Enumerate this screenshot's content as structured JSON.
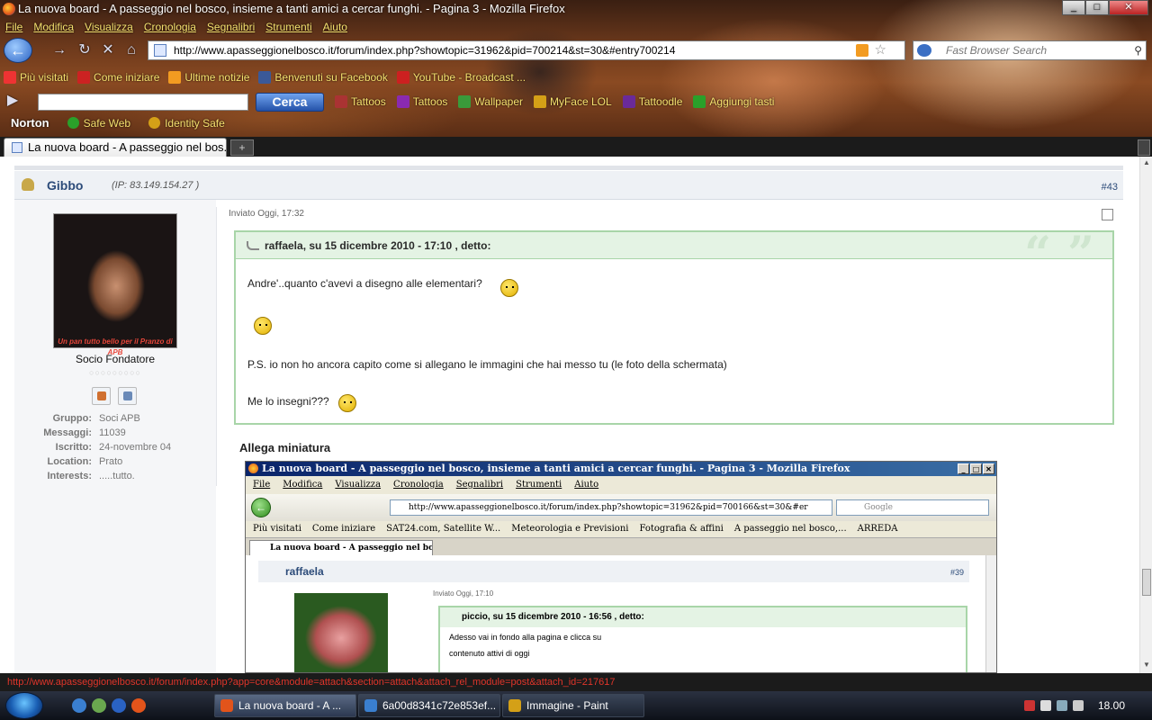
{
  "window": {
    "title": "La nuova board - A passeggio nel bosco, insieme a tanti amici a cercar funghi. - Pagina 3 - Mozilla Firefox",
    "controls": [
      "_",
      "□",
      "✕"
    ]
  },
  "menu": [
    "File",
    "Modifica",
    "Visualizza",
    "Cronologia",
    "Segnalibri",
    "Strumenti",
    "Aiuto"
  ],
  "nav": {
    "url": "http://www.apasseggionelbosco.it/forum/index.php?showtopic=31962&pid=700214&st=30&#entry700214",
    "search_placeholder": "Fast Browser Search"
  },
  "bookmarks": [
    {
      "label": "Più visitati",
      "color": "#e33"
    },
    {
      "label": "Come iniziare",
      "color": "#c22"
    },
    {
      "label": "Ultime notizie",
      "color": "#f29b21"
    },
    {
      "label": "Benvenuti su Facebook",
      "color": "#3b5998"
    },
    {
      "label": "YouTube - Broadcast ...",
      "color": "#cc2020"
    }
  ],
  "toolbar2": {
    "search_button": "Cerca",
    "links": [
      {
        "label": "Tattoos",
        "color": "#a33"
      },
      {
        "label": "Tattoos",
        "color": "#8a2ab0"
      },
      {
        "label": "Wallpaper",
        "color": "#3a9a3a"
      },
      {
        "label": "MyFace LOL",
        "color": "#d4a017"
      },
      {
        "label": "Tattoodle",
        "color": "#6a2a9a"
      },
      {
        "label": "Aggiungi tasti",
        "color": "#2aa02a"
      }
    ]
  },
  "norton": {
    "brand": "Norton",
    "items": [
      {
        "label": "Safe Web",
        "color": "#2aa02a"
      },
      {
        "label": "Identity Safe",
        "color": "#d4a017"
      }
    ]
  },
  "tab": {
    "label": "La nuova board - A passeggio nel bos...",
    "new_tab": "+"
  },
  "post": {
    "author": "Gibbo",
    "ip": "(IP: 83.149.154.27 )",
    "number": "#43",
    "date": "Inviato Oggi, 17:32",
    "avatar_caption": "Un pan tutto bello per il Pranzo di APB",
    "rank": "Socio Fondatore",
    "pips": "○○○○○○○○○",
    "meta": [
      {
        "k": "Gruppo:",
        "v": "Soci APB"
      },
      {
        "k": "Messaggi:",
        "v": "11039"
      },
      {
        "k": "Iscritto:",
        "v": "24-novembre 04"
      },
      {
        "k": "Location:",
        "v": "Prato"
      },
      {
        "k": "Interests:",
        "v": ".....tutto."
      }
    ],
    "quote": {
      "header": "raffaela, su 15 dicembre 2010 - 17:10 , detto:",
      "mark": "“ ”",
      "lines": [
        "Andre'..quanto c'avevi a disegno alle elementari?",
        "P.S. io non ho ancora capito come si allegano le immagini che hai messo tu (le foto della schermata)",
        "Me lo insegni???"
      ]
    },
    "attach_title": "Allega miniatura"
  },
  "shot": {
    "title": "La nuova board - A passeggio nel bosco, insieme a tanti amici a cercar funghi. - Pagina 3 - Mozilla Firefox",
    "menu": [
      "File",
      "Modifica",
      "Visualizza",
      "Cronologia",
      "Segnalibri",
      "Strumenti",
      "Aiuto"
    ],
    "url": "http://www.apasseggionelbosco.it/forum/index.php?showtopic=31962&pid=700166&st=30&#er",
    "search": "Google",
    "bookmarks": [
      "Più visitati",
      "Come iniziare",
      "SAT24.com, Satellite W...",
      "Meteorologia e Previsioni",
      "Fotografia & affini",
      "A passeggio nel bosco,...",
      "ARREDA"
    ],
    "tab": "La nuova board - A passeggio nel bosc...",
    "author": "raffaela",
    "number": "#39",
    "date": "Inviato Oggi, 17:10",
    "quote_header": "piccio, su 15 dicembre 2010 - 16:56 , detto:",
    "quote_lines": [
      "Adesso vai in fondo alla pagina e clicca su",
      "contenuto attivi di oggi"
    ]
  },
  "status": "http://www.apasseggionelbosco.it/forum/index.php?app=core&module=attach&section=attach&attach_rel_module=post&attach_id=217617",
  "taskbar": {
    "tasks": [
      {
        "label": "La nuova board - A ...",
        "color": "#e2541b",
        "active": true
      },
      {
        "label": "6a00d8341c72e853ef...",
        "color": "#3a7fd0",
        "active": false
      },
      {
        "label": "Immagine - Paint",
        "color": "#d4a017",
        "active": false
      }
    ],
    "clock": "18.00"
  }
}
